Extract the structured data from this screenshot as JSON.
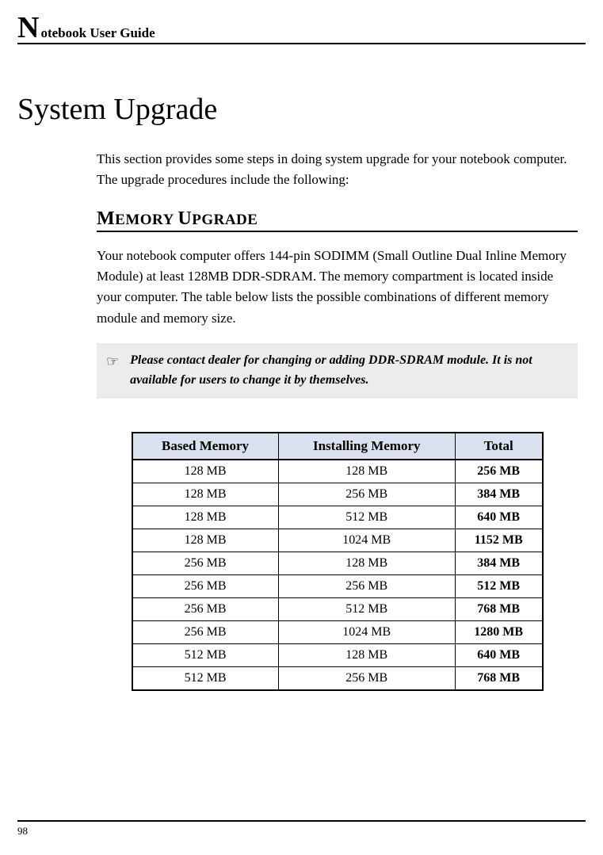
{
  "header": {
    "dropcap": "N",
    "rest": "otebook User Guide"
  },
  "title": "System Upgrade",
  "intro": "This section provides some steps in doing system upgrade for your notebook computer. The upgrade procedures include the following:",
  "section": {
    "big1": "M",
    "rest1": "EMORY ",
    "big2": "U",
    "rest2": "PGRADE"
  },
  "body": "Your notebook computer offers 144-pin SODIMM (Small Outline Dual Inline Memory Module) at least 128MB DDR-SDRAM. The memory compartment is located inside your computer. The table below lists the possible combinations of different memory module and memory size.",
  "note": {
    "icon": "☞",
    "text": "Please contact dealer for changing or adding DDR-SDRAM module. It is not available for users to change it by themselves."
  },
  "table": {
    "headers": [
      "Based Memory",
      "Installing Memory",
      "Total"
    ],
    "rows": [
      [
        "128 MB",
        "128 MB",
        "256 MB"
      ],
      [
        "128 MB",
        "256 MB",
        "384 MB"
      ],
      [
        "128 MB",
        "512 MB",
        "640 MB"
      ],
      [
        "128 MB",
        "1024 MB",
        "1152 MB"
      ],
      [
        "256 MB",
        "128 MB",
        "384 MB"
      ],
      [
        "256 MB",
        "256 MB",
        "512 MB"
      ],
      [
        "256 MB",
        "512 MB",
        "768 MB"
      ],
      [
        "256 MB",
        "1024 MB",
        "1280 MB"
      ],
      [
        "512 MB",
        "128 MB",
        "640 MB"
      ],
      [
        "512 MB",
        "256 MB",
        "768 MB"
      ]
    ]
  },
  "page_number": "98"
}
